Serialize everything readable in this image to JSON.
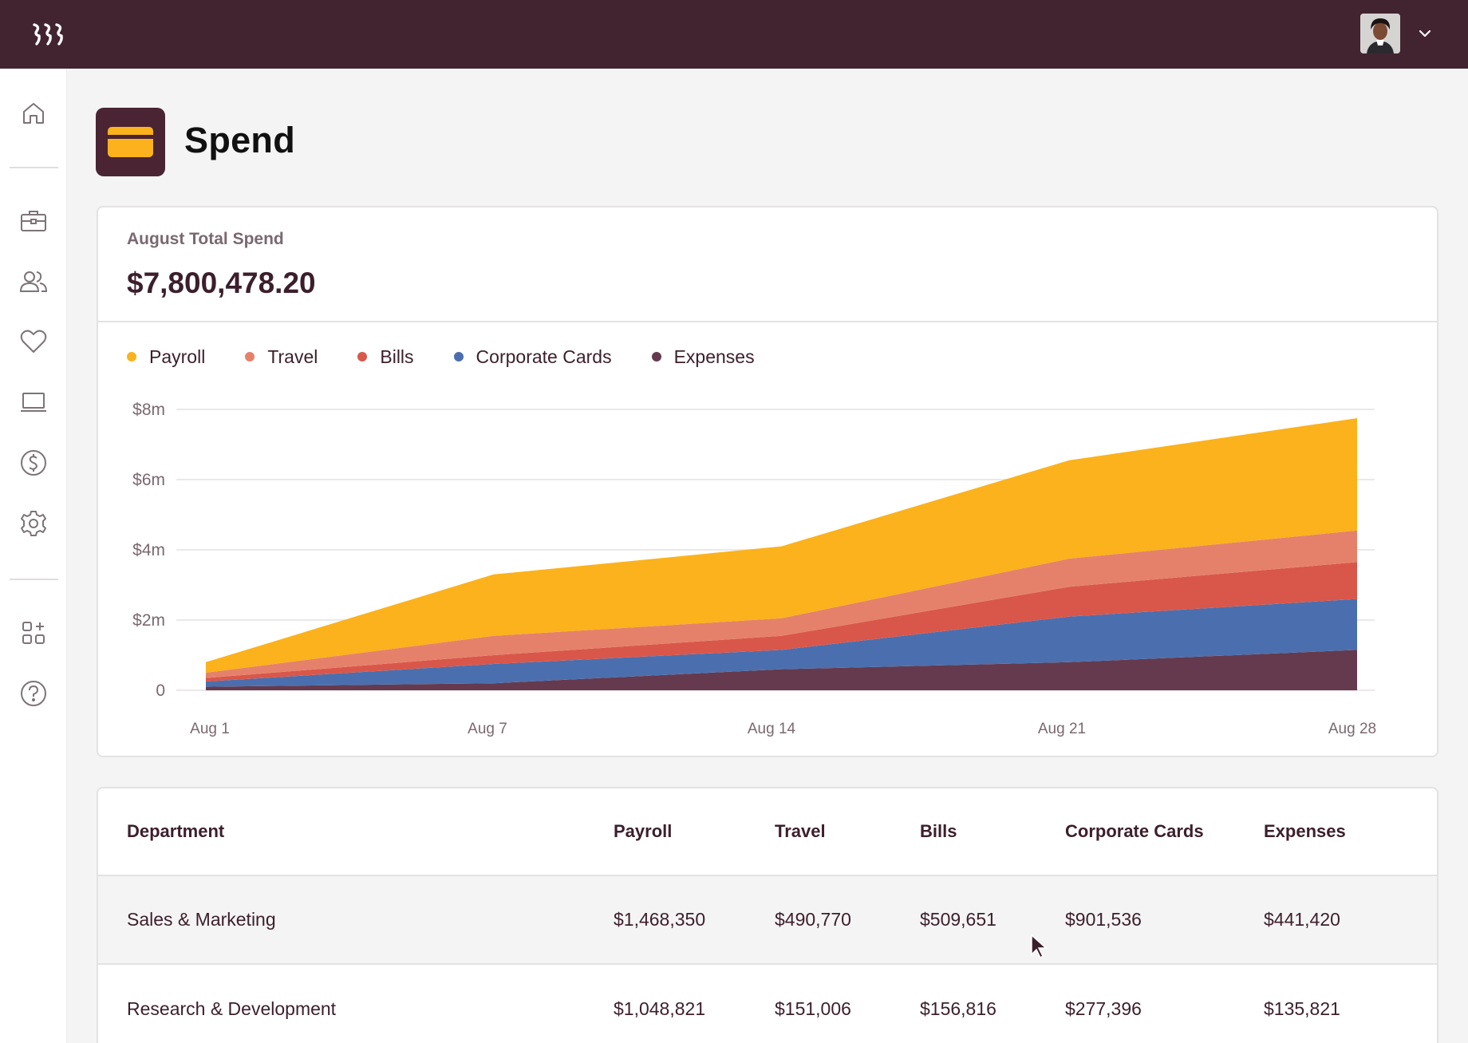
{
  "page": {
    "title": "Spend"
  },
  "colors": {
    "topbar": "#422430",
    "payroll": "#fbb21c",
    "travel": "#e5816b",
    "bills": "#d9574a",
    "corporate_cards": "#4b6fae",
    "expenses": "#653a4e"
  },
  "topbar": {
    "logo_icon": "rippling-logo-icon",
    "avatar_icon": "user-avatar",
    "menu_icon": "chevron-down-icon"
  },
  "sidebar": {
    "items": [
      {
        "icon": "home-icon"
      },
      {
        "icon": "briefcase-icon"
      },
      {
        "icon": "people-icon"
      },
      {
        "icon": "heart-icon"
      },
      {
        "icon": "laptop-icon"
      },
      {
        "icon": "dollar-icon"
      },
      {
        "icon": "gear-icon"
      },
      {
        "icon": "apps-add-icon"
      },
      {
        "icon": "help-icon"
      }
    ]
  },
  "summary": {
    "label": "August Total Spend",
    "value": "$7,800,478.20"
  },
  "chart_data": {
    "type": "area",
    "stacked": true,
    "x": [
      "Aug 1",
      "Aug 7",
      "Aug 14",
      "Aug 21",
      "Aug 28"
    ],
    "y_ticks": [
      "0",
      "$2m",
      "$4m",
      "$6m",
      "$8m"
    ],
    "ylim": [
      0,
      8
    ],
    "y_unit": "millions USD",
    "legend_position": "top-left",
    "grid": true,
    "series": [
      {
        "name": "Expenses",
        "color": "#653a4e",
        "values": [
          0.1,
          0.2,
          0.6,
          0.8,
          1.15
        ]
      },
      {
        "name": "Corporate Cards",
        "color": "#4b6fae",
        "values": [
          0.15,
          0.55,
          0.55,
          1.3,
          1.45
        ]
      },
      {
        "name": "Bills",
        "color": "#d9574a",
        "values": [
          0.1,
          0.25,
          0.4,
          0.85,
          1.05
        ]
      },
      {
        "name": "Travel",
        "color": "#e5816b",
        "values": [
          0.15,
          0.55,
          0.5,
          0.8,
          0.9
        ]
      },
      {
        "name": "Payroll",
        "color": "#fbb21c",
        "values": [
          0.3,
          1.75,
          2.05,
          2.8,
          3.2
        ]
      }
    ]
  },
  "legend": [
    {
      "label": "Payroll",
      "color": "#fbb21c"
    },
    {
      "label": "Travel",
      "color": "#e5816b"
    },
    {
      "label": "Bills",
      "color": "#d9574a"
    },
    {
      "label": "Corporate Cards",
      "color": "#4b6fae"
    },
    {
      "label": "Expenses",
      "color": "#653a4e"
    }
  ],
  "table": {
    "headers": [
      "Department",
      "Payroll",
      "Travel",
      "Bills",
      "Corporate Cards",
      "Expenses"
    ],
    "rows": [
      [
        "Sales & Marketing",
        "$1,468,350",
        "$490,770",
        "$509,651",
        "$901,536",
        "$441,420"
      ],
      [
        "Research & Development",
        "$1,048,821",
        "$151,006",
        "$156,816",
        "$277,396",
        "$135,821"
      ]
    ]
  }
}
